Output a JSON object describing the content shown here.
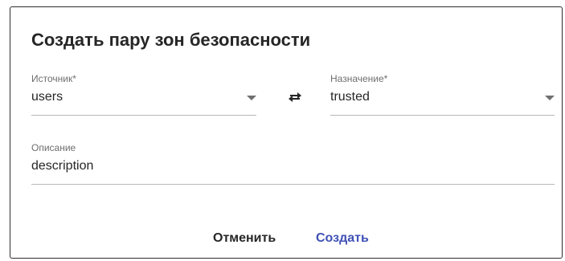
{
  "dialog": {
    "title": "Создать пару зон безопасности",
    "source": {
      "label": "Источник*",
      "value": "users"
    },
    "destination": {
      "label": "Назначение*",
      "value": "trusted"
    },
    "swap_icon": "swap-arrows-icon",
    "description": {
      "label": "Описание",
      "value": "description"
    },
    "buttons": {
      "cancel": "Отменить",
      "create": "Создать"
    }
  },
  "colors": {
    "primary": "#3f51b5",
    "text": "#262626",
    "label": "#6e6e6e",
    "underline": "#b8b8b8"
  }
}
